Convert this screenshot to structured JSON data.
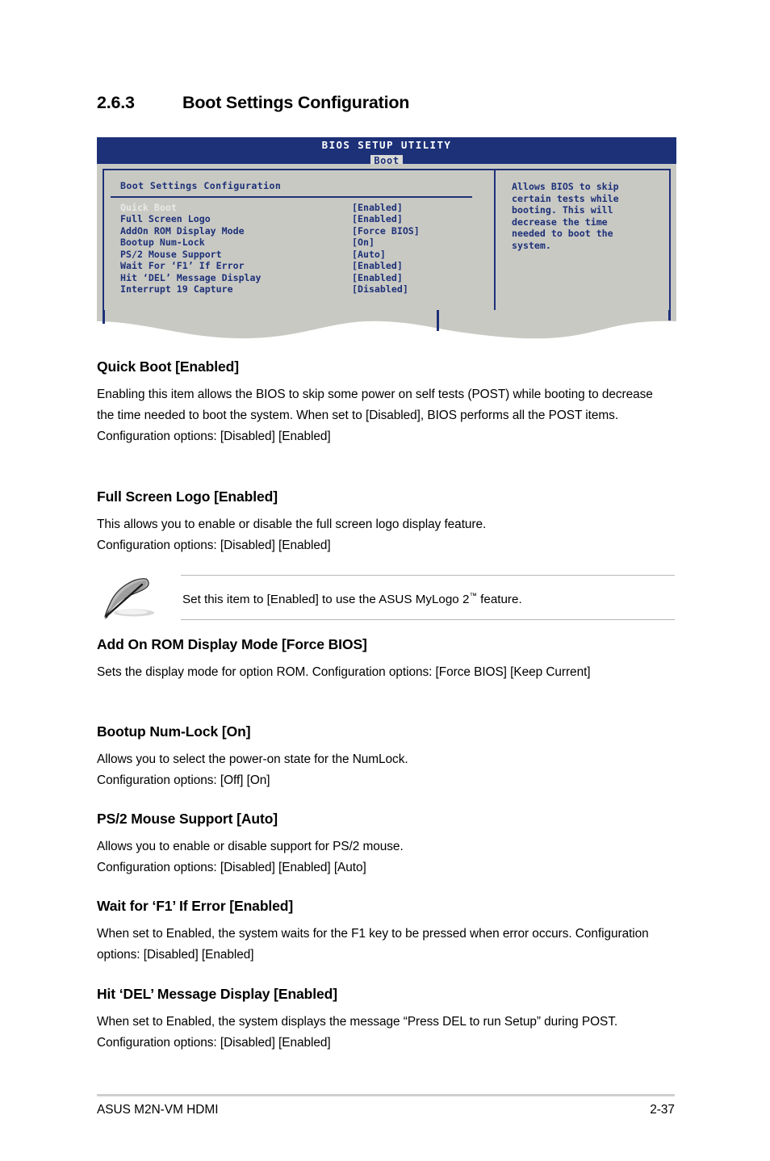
{
  "section": {
    "number": "2.6.3",
    "title": "Boot Settings Configuration"
  },
  "bios": {
    "utility_title": "BIOS SETUP UTILITY",
    "active_tab": "Boot",
    "panel_title": "Boot Settings Configuration",
    "items": [
      {
        "label": "Quick Boot",
        "value": "[Enabled]",
        "selected": true
      },
      {
        "label": "Full Screen Logo",
        "value": "[Enabled]",
        "selected": false
      },
      {
        "label": "AddOn ROM Display Mode",
        "value": "[Force BIOS]",
        "selected": false
      },
      {
        "label": "Bootup Num-Lock",
        "value": "[On]",
        "selected": false
      },
      {
        "label": "PS/2 Mouse Support",
        "value": "[Auto]",
        "selected": false
      },
      {
        "label": "Wait For ‘F1’ If Error",
        "value": "[Enabled]",
        "selected": false
      },
      {
        "label": "Hit ‘DEL’ Message Display",
        "value": "[Enabled]",
        "selected": false
      },
      {
        "label": "Interrupt 19 Capture",
        "value": "[Disabled]",
        "selected": false
      }
    ],
    "help_text": "Allows BIOS to skip\ncertain tests while\nbooting. This will\ndecrease the time\nneeded to boot the\nsystem.",
    "colors": {
      "header_blue": "#1d3178",
      "panel_gray": "#c9c9c4",
      "tab_background": "#d9d9d6",
      "selected_text": "#e8e8e6"
    }
  },
  "sections": [
    {
      "heading": "Quick Boot [Enabled]",
      "body": "Enabling this item allows the BIOS to skip some power on self tests (POST) while booting to decrease the time needed to boot the system. When set to [Disabled], BIOS performs all the POST items.\nConfiguration options: [Disabled] [Enabled]"
    },
    {
      "heading": "Full Screen Logo [Enabled]",
      "body": "This allows you to enable or disable the full screen logo display feature.\nConfiguration options: [Disabled] [Enabled]"
    },
    {
      "heading": "Add On ROM Display Mode [Force BIOS]",
      "body": "Sets the display mode for option ROM. Configuration options: [Force BIOS] [Keep Current]"
    },
    {
      "heading": "Bootup Num-Lock [On]",
      "body": "Allows you to select the power-on state for the NumLock.\nConfiguration options: [Off] [On]"
    },
    {
      "heading": "PS/2 Mouse Support [Auto]",
      "body": "Allows you to enable or disable support for PS/2 mouse.\nConfiguration options: [Disabled] [Enabled] [Auto]"
    },
    {
      "heading": "Wait for ‘F1’ If Error [Enabled]",
      "body": "When set to Enabled, the system waits for the F1 key to be pressed when error occurs. Configuration options: [Disabled] [Enabled]"
    },
    {
      "heading": "Hit ‘DEL’ Message Display [Enabled]",
      "body": "When set to Enabled, the system displays the message “Press DEL to run Setup” during POST. Configuration options: [Disabled] [Enabled]"
    }
  ],
  "note": {
    "icon": "quill-pen-icon",
    "text_before": "Set this item to [Enabled] to use the ASUS MyLogo 2",
    "text_superscript": "™",
    "text_after": " feature."
  },
  "footer": {
    "left": "ASUS M2N-VM HDMI",
    "right": "2-37"
  }
}
